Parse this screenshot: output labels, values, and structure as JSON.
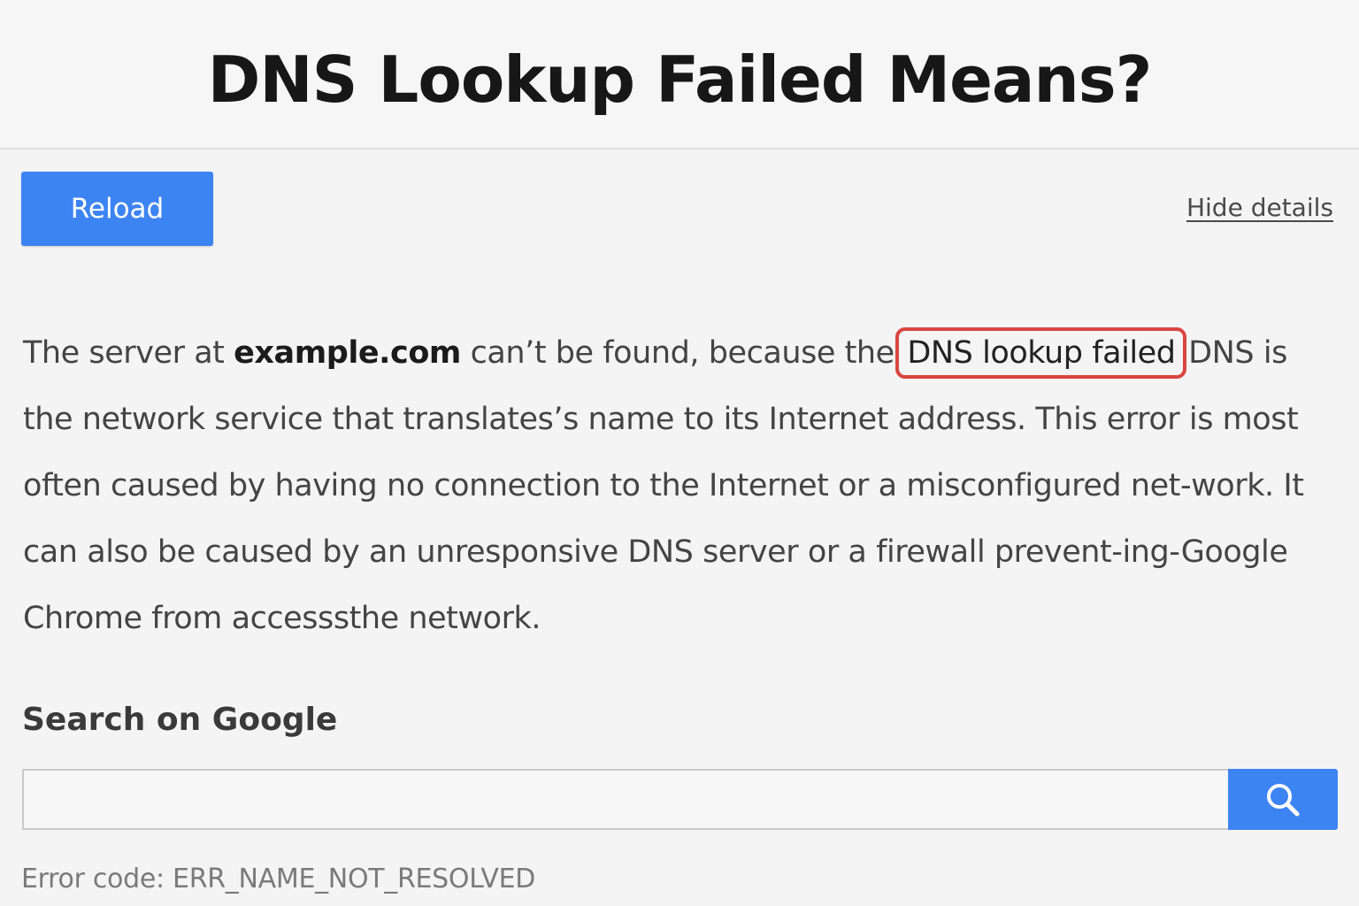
{
  "header": {
    "title": "DNS Lookup Failed Means?"
  },
  "actions": {
    "reload_label": "Reload",
    "hide_details_label": "Hide details"
  },
  "message": {
    "part1": "The server at ",
    "host": "example.com",
    "part2": " can’t be found, because the ",
    "highlighted": "DNS lookup failed",
    "part3": " DNS is the network service that translates’s name to its Internet address. This error is most often caused by having no connection to the Internet or a misconfigured net-work. It can also be caused by an unresponsive DNS server or a firewall prevent-ing-Google Chrome from accesssthe network.",
    "highlight_color": "#d9453f"
  },
  "search": {
    "heading": "Search on Google",
    "value": "",
    "button_icon": "search-icon"
  },
  "error": {
    "code_text": "Error code: ERR_NAME_NOT_RESOLVED"
  },
  "colors": {
    "accent": "#3d84f3",
    "background": "#f4f4f4"
  }
}
